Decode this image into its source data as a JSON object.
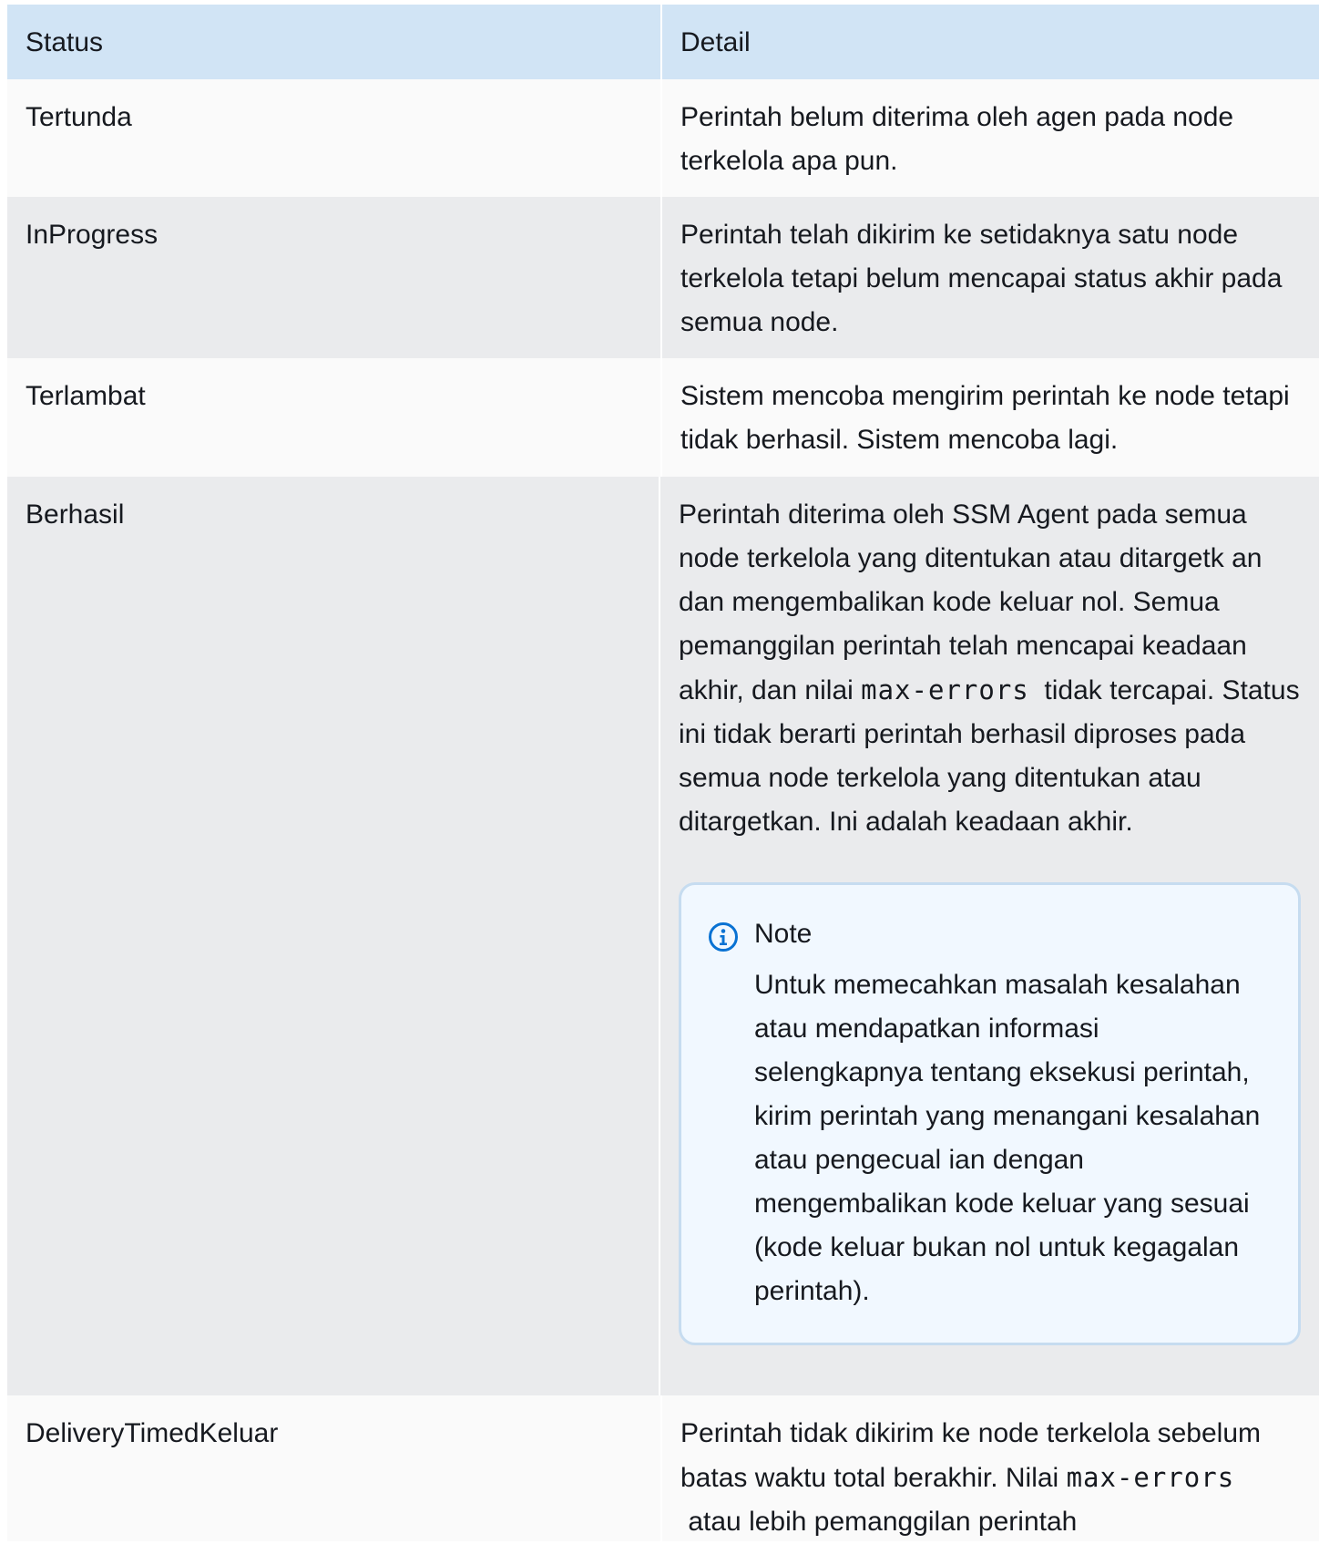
{
  "table": {
    "header": {
      "status": "Status",
      "detail": "Detail"
    },
    "rows": [
      {
        "status": "Tertunda",
        "detail": "Perintah belum diterima oleh agen pada node terkelola apa pun."
      },
      {
        "status": "InProgress",
        "detail": "Perintah telah dikirim ke setidaknya satu node terkelola tetapi belum mencapai status akhir pada semua node."
      },
      {
        "status": "Terlambat",
        "detail": "Sistem mencoba mengirim perintah ke node tetapi tidak berhasil. Sistem mencoba lagi."
      },
      {
        "status": "Berhasil",
        "detail_before": "Perintah diterima oleh SSM Agent pada semua node terkelola yang ditentukan atau ditargetk an dan mengembalikan kode keluar nol. Semua pemanggilan perintah telah mencapai keadaan akhir, dan nilai",
        "detail_code": "max-errors",
        "detail_after": "tidak tercapai. Status ini tidak berarti perintah berhasil diproses pada semua node terkelola yang ditentukan atau ditargetkan. Ini adalah keadaan akhir.",
        "note": {
          "icon": "info-icon",
          "title": "Note",
          "body": "Untuk memecahkan masalah kesalahan atau mendapatkan informasi selengkapnya tentang eksekusi perintah, kirim perintah yang menangani kesalahan atau pengecual ian dengan mengembalikan kode keluar yang sesuai (kode keluar bukan nol untuk kegagalan perintah)."
        }
      },
      {
        "status": "DeliveryTimedKeluar",
        "detail_before": "Perintah tidak dikirim ke node terkelola sebelum batas waktu total berakhir. Nilai",
        "detail_code": "max-errors",
        "detail_after": "atau lebih pemanggilan perintah"
      }
    ]
  },
  "colors": {
    "header_bg": "#d1e4f5",
    "row_light": "#fafafa",
    "row_dark": "#eaebed",
    "note_bg": "#f1f8ff",
    "note_border": "#c6dcf0",
    "info_icon": "#0972d3"
  }
}
